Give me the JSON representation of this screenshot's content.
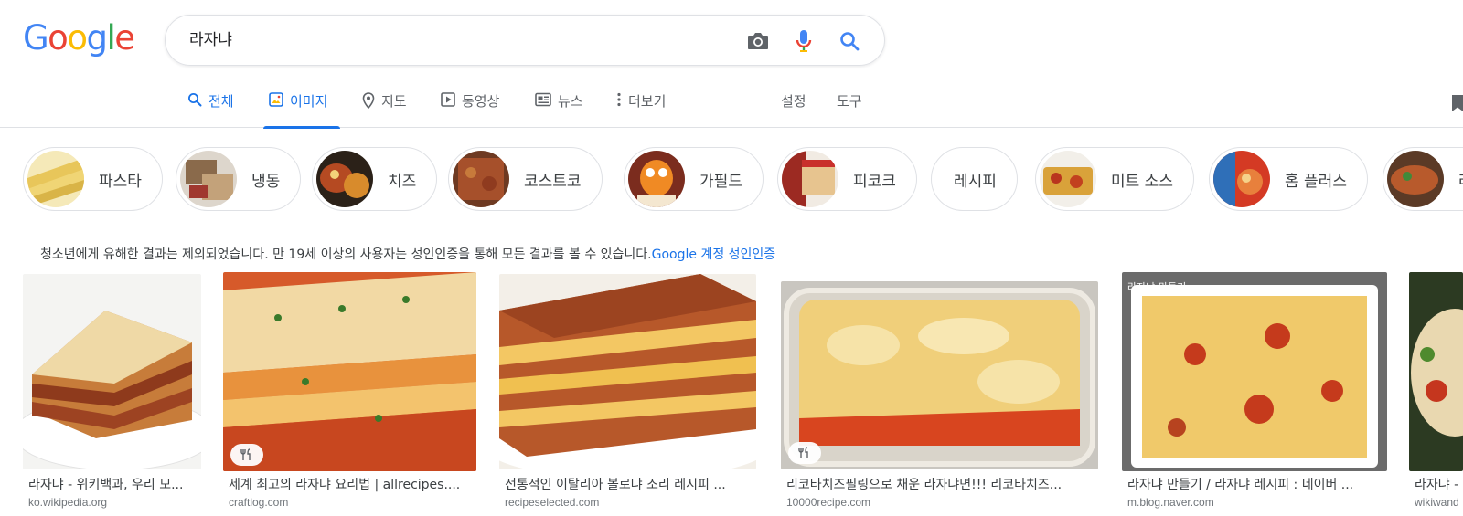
{
  "brand": {
    "logo_letters": [
      "G",
      "o",
      "o",
      "g",
      "l",
      "e"
    ],
    "logo_colors": [
      "#4285F4",
      "#EA4335",
      "#FBBC05",
      "#4285F4",
      "#34A853",
      "#EA4335"
    ]
  },
  "search": {
    "query": "라자냐",
    "icons": [
      "camera-icon",
      "microphone-icon",
      "search-icon"
    ]
  },
  "tabs": {
    "all": "전체",
    "images": "이미지",
    "maps": "지도",
    "videos": "동영상",
    "news": "뉴스",
    "more": "더보기",
    "settings": "설정",
    "tools": "도구",
    "active": "images"
  },
  "chips": [
    {
      "label": "파스타",
      "has_image": true
    },
    {
      "label": "냉동",
      "has_image": true
    },
    {
      "label": "치즈",
      "has_image": true
    },
    {
      "label": "코스트코",
      "has_image": true
    },
    {
      "label": "가필드",
      "has_image": true
    },
    {
      "label": "피코크",
      "has_image": true
    },
    {
      "label": "레시피",
      "has_image": false
    },
    {
      "label": "미트 소스",
      "has_image": true
    },
    {
      "label": "홈 플러스",
      "has_image": true
    },
    {
      "label": "라",
      "has_image": true
    }
  ],
  "notice": {
    "text": "청소년에게 유해한 결과는 제외되었습니다. 만 19세 이상의 사용자는 성인인증을 통해 모든 결과를 볼 수 있습니다.",
    "link": "Google 계정 성인인증"
  },
  "results": [
    {
      "title": "라자냐 - 위키백과, 우리 모...",
      "source": "ko.wikipedia.org",
      "recipe_badge": false
    },
    {
      "title": "세계 최고의 라자냐 요리법 | allrecipes....",
      "source": "craftlog.com",
      "recipe_badge": true
    },
    {
      "title": "전통적인 이탈리아 볼로냐 조리 레시피 ...",
      "source": "recipeselected.com",
      "recipe_badge": false
    },
    {
      "title": "리코타치즈필링으로 채운 라자냐면!!! 리코타치즈...",
      "source": "10000recipe.com",
      "recipe_badge": true
    },
    {
      "title": "라자냐 만들기 / 라자냐 레시피 : 네이버 ...",
      "source": "m.blog.naver.com",
      "recipe_badge": false,
      "overlay_text": "라자냐 만들기"
    },
    {
      "title": "라자냐 -",
      "source": "wikiwand",
      "recipe_badge": false
    }
  ],
  "colors": {
    "accent": "#1a73e8",
    "border": "#dfe1e5",
    "text": "#202124",
    "muted": "#5f6368"
  }
}
